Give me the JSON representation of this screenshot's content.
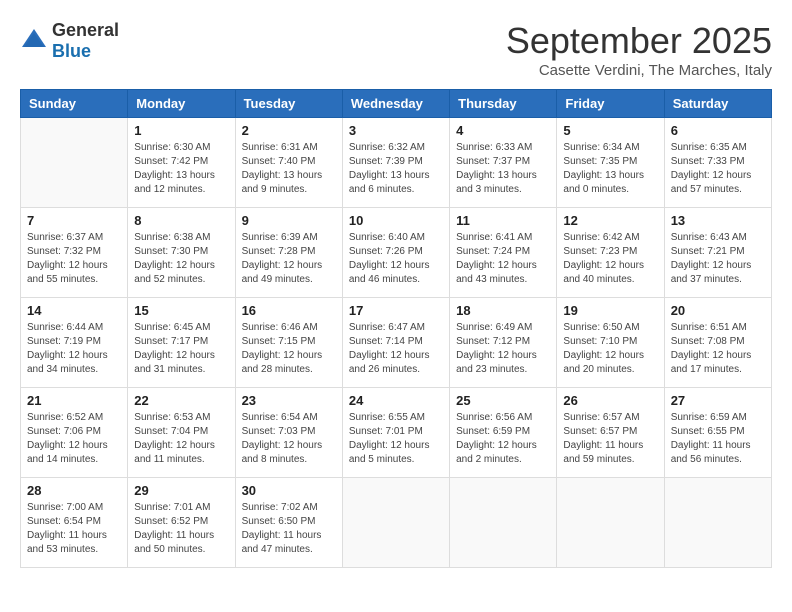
{
  "header": {
    "logo_general": "General",
    "logo_blue": "Blue",
    "month_title": "September 2025",
    "location": "Casette Verdini, The Marches, Italy"
  },
  "days_of_week": [
    "Sunday",
    "Monday",
    "Tuesday",
    "Wednesday",
    "Thursday",
    "Friday",
    "Saturday"
  ],
  "weeks": [
    [
      {
        "day": "",
        "info": ""
      },
      {
        "day": "1",
        "info": "Sunrise: 6:30 AM\nSunset: 7:42 PM\nDaylight: 13 hours\nand 12 minutes."
      },
      {
        "day": "2",
        "info": "Sunrise: 6:31 AM\nSunset: 7:40 PM\nDaylight: 13 hours\nand 9 minutes."
      },
      {
        "day": "3",
        "info": "Sunrise: 6:32 AM\nSunset: 7:39 PM\nDaylight: 13 hours\nand 6 minutes."
      },
      {
        "day": "4",
        "info": "Sunrise: 6:33 AM\nSunset: 7:37 PM\nDaylight: 13 hours\nand 3 minutes."
      },
      {
        "day": "5",
        "info": "Sunrise: 6:34 AM\nSunset: 7:35 PM\nDaylight: 13 hours\nand 0 minutes."
      },
      {
        "day": "6",
        "info": "Sunrise: 6:35 AM\nSunset: 7:33 PM\nDaylight: 12 hours\nand 57 minutes."
      }
    ],
    [
      {
        "day": "7",
        "info": "Sunrise: 6:37 AM\nSunset: 7:32 PM\nDaylight: 12 hours\nand 55 minutes."
      },
      {
        "day": "8",
        "info": "Sunrise: 6:38 AM\nSunset: 7:30 PM\nDaylight: 12 hours\nand 52 minutes."
      },
      {
        "day": "9",
        "info": "Sunrise: 6:39 AM\nSunset: 7:28 PM\nDaylight: 12 hours\nand 49 minutes."
      },
      {
        "day": "10",
        "info": "Sunrise: 6:40 AM\nSunset: 7:26 PM\nDaylight: 12 hours\nand 46 minutes."
      },
      {
        "day": "11",
        "info": "Sunrise: 6:41 AM\nSunset: 7:24 PM\nDaylight: 12 hours\nand 43 minutes."
      },
      {
        "day": "12",
        "info": "Sunrise: 6:42 AM\nSunset: 7:23 PM\nDaylight: 12 hours\nand 40 minutes."
      },
      {
        "day": "13",
        "info": "Sunrise: 6:43 AM\nSunset: 7:21 PM\nDaylight: 12 hours\nand 37 minutes."
      }
    ],
    [
      {
        "day": "14",
        "info": "Sunrise: 6:44 AM\nSunset: 7:19 PM\nDaylight: 12 hours\nand 34 minutes."
      },
      {
        "day": "15",
        "info": "Sunrise: 6:45 AM\nSunset: 7:17 PM\nDaylight: 12 hours\nand 31 minutes."
      },
      {
        "day": "16",
        "info": "Sunrise: 6:46 AM\nSunset: 7:15 PM\nDaylight: 12 hours\nand 28 minutes."
      },
      {
        "day": "17",
        "info": "Sunrise: 6:47 AM\nSunset: 7:14 PM\nDaylight: 12 hours\nand 26 minutes."
      },
      {
        "day": "18",
        "info": "Sunrise: 6:49 AM\nSunset: 7:12 PM\nDaylight: 12 hours\nand 23 minutes."
      },
      {
        "day": "19",
        "info": "Sunrise: 6:50 AM\nSunset: 7:10 PM\nDaylight: 12 hours\nand 20 minutes."
      },
      {
        "day": "20",
        "info": "Sunrise: 6:51 AM\nSunset: 7:08 PM\nDaylight: 12 hours\nand 17 minutes."
      }
    ],
    [
      {
        "day": "21",
        "info": "Sunrise: 6:52 AM\nSunset: 7:06 PM\nDaylight: 12 hours\nand 14 minutes."
      },
      {
        "day": "22",
        "info": "Sunrise: 6:53 AM\nSunset: 7:04 PM\nDaylight: 12 hours\nand 11 minutes."
      },
      {
        "day": "23",
        "info": "Sunrise: 6:54 AM\nSunset: 7:03 PM\nDaylight: 12 hours\nand 8 minutes."
      },
      {
        "day": "24",
        "info": "Sunrise: 6:55 AM\nSunset: 7:01 PM\nDaylight: 12 hours\nand 5 minutes."
      },
      {
        "day": "25",
        "info": "Sunrise: 6:56 AM\nSunset: 6:59 PM\nDaylight: 12 hours\nand 2 minutes."
      },
      {
        "day": "26",
        "info": "Sunrise: 6:57 AM\nSunset: 6:57 PM\nDaylight: 11 hours\nand 59 minutes."
      },
      {
        "day": "27",
        "info": "Sunrise: 6:59 AM\nSunset: 6:55 PM\nDaylight: 11 hours\nand 56 minutes."
      }
    ],
    [
      {
        "day": "28",
        "info": "Sunrise: 7:00 AM\nSunset: 6:54 PM\nDaylight: 11 hours\nand 53 minutes."
      },
      {
        "day": "29",
        "info": "Sunrise: 7:01 AM\nSunset: 6:52 PM\nDaylight: 11 hours\nand 50 minutes."
      },
      {
        "day": "30",
        "info": "Sunrise: 7:02 AM\nSunset: 6:50 PM\nDaylight: 11 hours\nand 47 minutes."
      },
      {
        "day": "",
        "info": ""
      },
      {
        "day": "",
        "info": ""
      },
      {
        "day": "",
        "info": ""
      },
      {
        "day": "",
        "info": ""
      }
    ]
  ]
}
